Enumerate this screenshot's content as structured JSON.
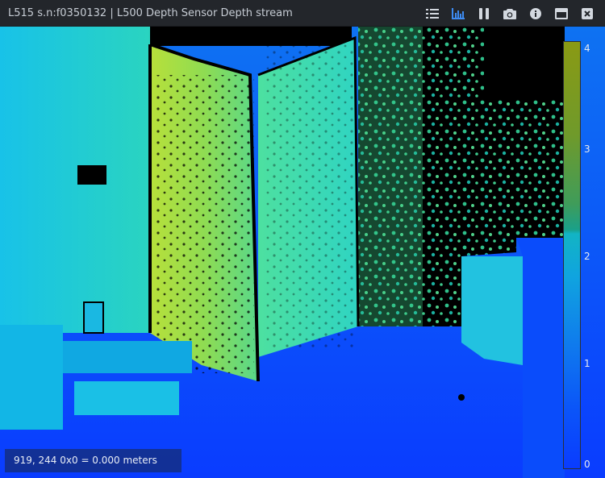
{
  "window": {
    "title": "L515 s.n:f0350132 | L500 Depth Sensor Depth stream"
  },
  "toolbar": {
    "buttons": [
      {
        "icon": "stream-info-list-icon",
        "active": false
      },
      {
        "icon": "metrics-chart-icon",
        "active": true
      },
      {
        "icon": "pause-icon",
        "active": false
      },
      {
        "icon": "camera-snapshot-icon",
        "active": false
      },
      {
        "icon": "info-icon",
        "active": false
      },
      {
        "icon": "maximize-window-icon",
        "active": false
      },
      {
        "icon": "close-icon",
        "active": false
      }
    ],
    "colors": {
      "default": "#d3d8df",
      "active": "#3d8bf2",
      "close": "#d3d8df"
    }
  },
  "depth_view": {
    "colormap": "jet",
    "scale": {
      "ticks": [
        "4",
        "3",
        "2",
        "1",
        "0"
      ],
      "range": [
        0,
        4
      ],
      "unit": "meters"
    },
    "readout": "919, 244 0x0 = 0.000 meters"
  }
}
